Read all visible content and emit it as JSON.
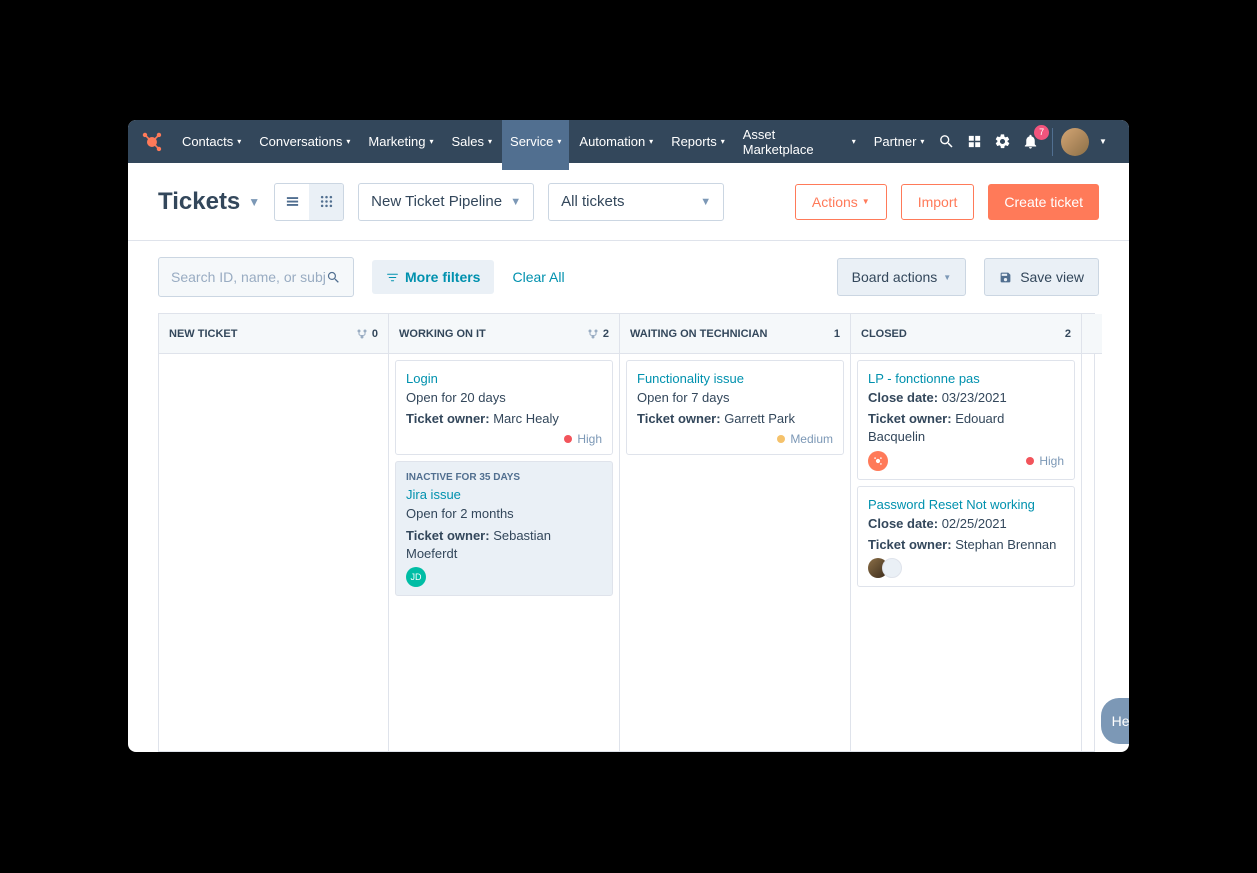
{
  "nav": {
    "items": [
      "Contacts",
      "Conversations",
      "Marketing",
      "Sales",
      "Service",
      "Automation",
      "Reports",
      "Asset Marketplace",
      "Partner"
    ],
    "activeIndex": 4,
    "notificationCount": "7"
  },
  "toolbar": {
    "pageTitle": "Tickets",
    "pipelineSelect": "New Ticket Pipeline",
    "ticketSelect": "All tickets",
    "actions": "Actions",
    "import": "Import",
    "create": "Create ticket"
  },
  "filterbar": {
    "searchPlaceholder": "Search ID, name, or subject",
    "moreFilters": "More filters",
    "clearAll": "Clear All",
    "boardActions": "Board actions",
    "saveView": "Save view"
  },
  "columns": [
    {
      "title": "NEW TICKET",
      "count": "0",
      "showBranch": true
    },
    {
      "title": "WORKING ON IT",
      "count": "2",
      "showBranch": true
    },
    {
      "title": "WAITING ON TECHNICIAN",
      "count": "1",
      "showBranch": false
    },
    {
      "title": "CLOSED",
      "count": "2",
      "showBranch": false
    }
  ],
  "cards": {
    "col1": [
      {
        "title": "Login",
        "line1": "Open for 20 days",
        "ownerLabel": "Ticket owner:",
        "owner": "Marc Healy",
        "priority": "High",
        "priorityClass": "high",
        "inactive": false
      },
      {
        "title": "Jira issue",
        "line1": "Open for 2 months",
        "ownerLabel": "Ticket owner:",
        "owner": "Sebastian Moeferdt",
        "inactive": true,
        "inactiveLabel": "INACTIVE FOR 35 DAYS",
        "avatarInitials": "JD"
      }
    ],
    "col2": [
      {
        "title": "Functionality issue",
        "line1": "Open for 7 days",
        "ownerLabel": "Ticket owner:",
        "owner": "Garrett Park",
        "priority": "Medium",
        "priorityClass": "medium",
        "inactive": false
      }
    ],
    "col3": [
      {
        "title": "LP - fonctionne pas",
        "dateLabel": "Close date:",
        "date": "03/23/2021",
        "ownerLabel": "Ticket owner:",
        "owner": "Edouard Bacquelin",
        "priority": "High",
        "priorityClass": "high",
        "avatarKind": "orange"
      },
      {
        "title": "Password Reset Not working",
        "dateLabel": "Close date:",
        "date": "02/25/2021",
        "ownerLabel": "Ticket owner:",
        "owner": "Stephan Brennan",
        "avatarKind": "photo-blank"
      }
    ]
  },
  "help": "Help"
}
